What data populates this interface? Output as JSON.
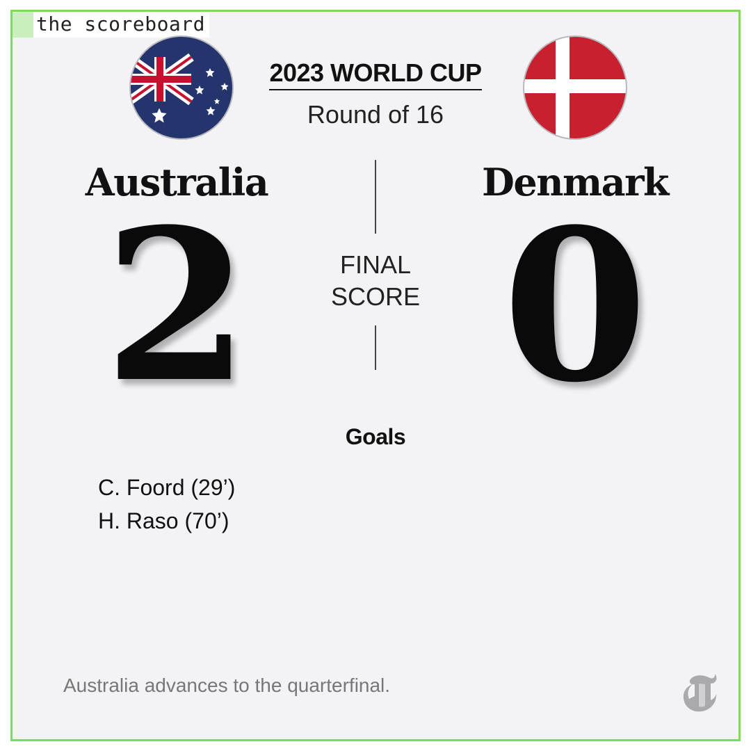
{
  "tag": {
    "label": "the scoreboard"
  },
  "header": {
    "competition": "2023 WORLD CUP",
    "round": "Round of 16"
  },
  "home": {
    "name": "Australia",
    "score": "2",
    "flag_icon": "australia-flag-icon"
  },
  "away": {
    "name": "Denmark",
    "score": "0",
    "flag_icon": "denmark-flag-icon"
  },
  "status": {
    "line1": "FINAL",
    "line2": "SCORE"
  },
  "goals": {
    "heading": "Goals",
    "home": [
      "C. Foord (29’)",
      "H. Raso (70’)"
    ]
  },
  "footer": {
    "note": "Australia advances to the quarterfinal.",
    "logo_icon": "nyt-t-logo-icon"
  },
  "colors": {
    "frame_border": "#7bdc5a",
    "background": "#f3f3f6",
    "au_blue": "#24356e",
    "au_red": "#c8102e",
    "dk_red": "#c8202f"
  }
}
